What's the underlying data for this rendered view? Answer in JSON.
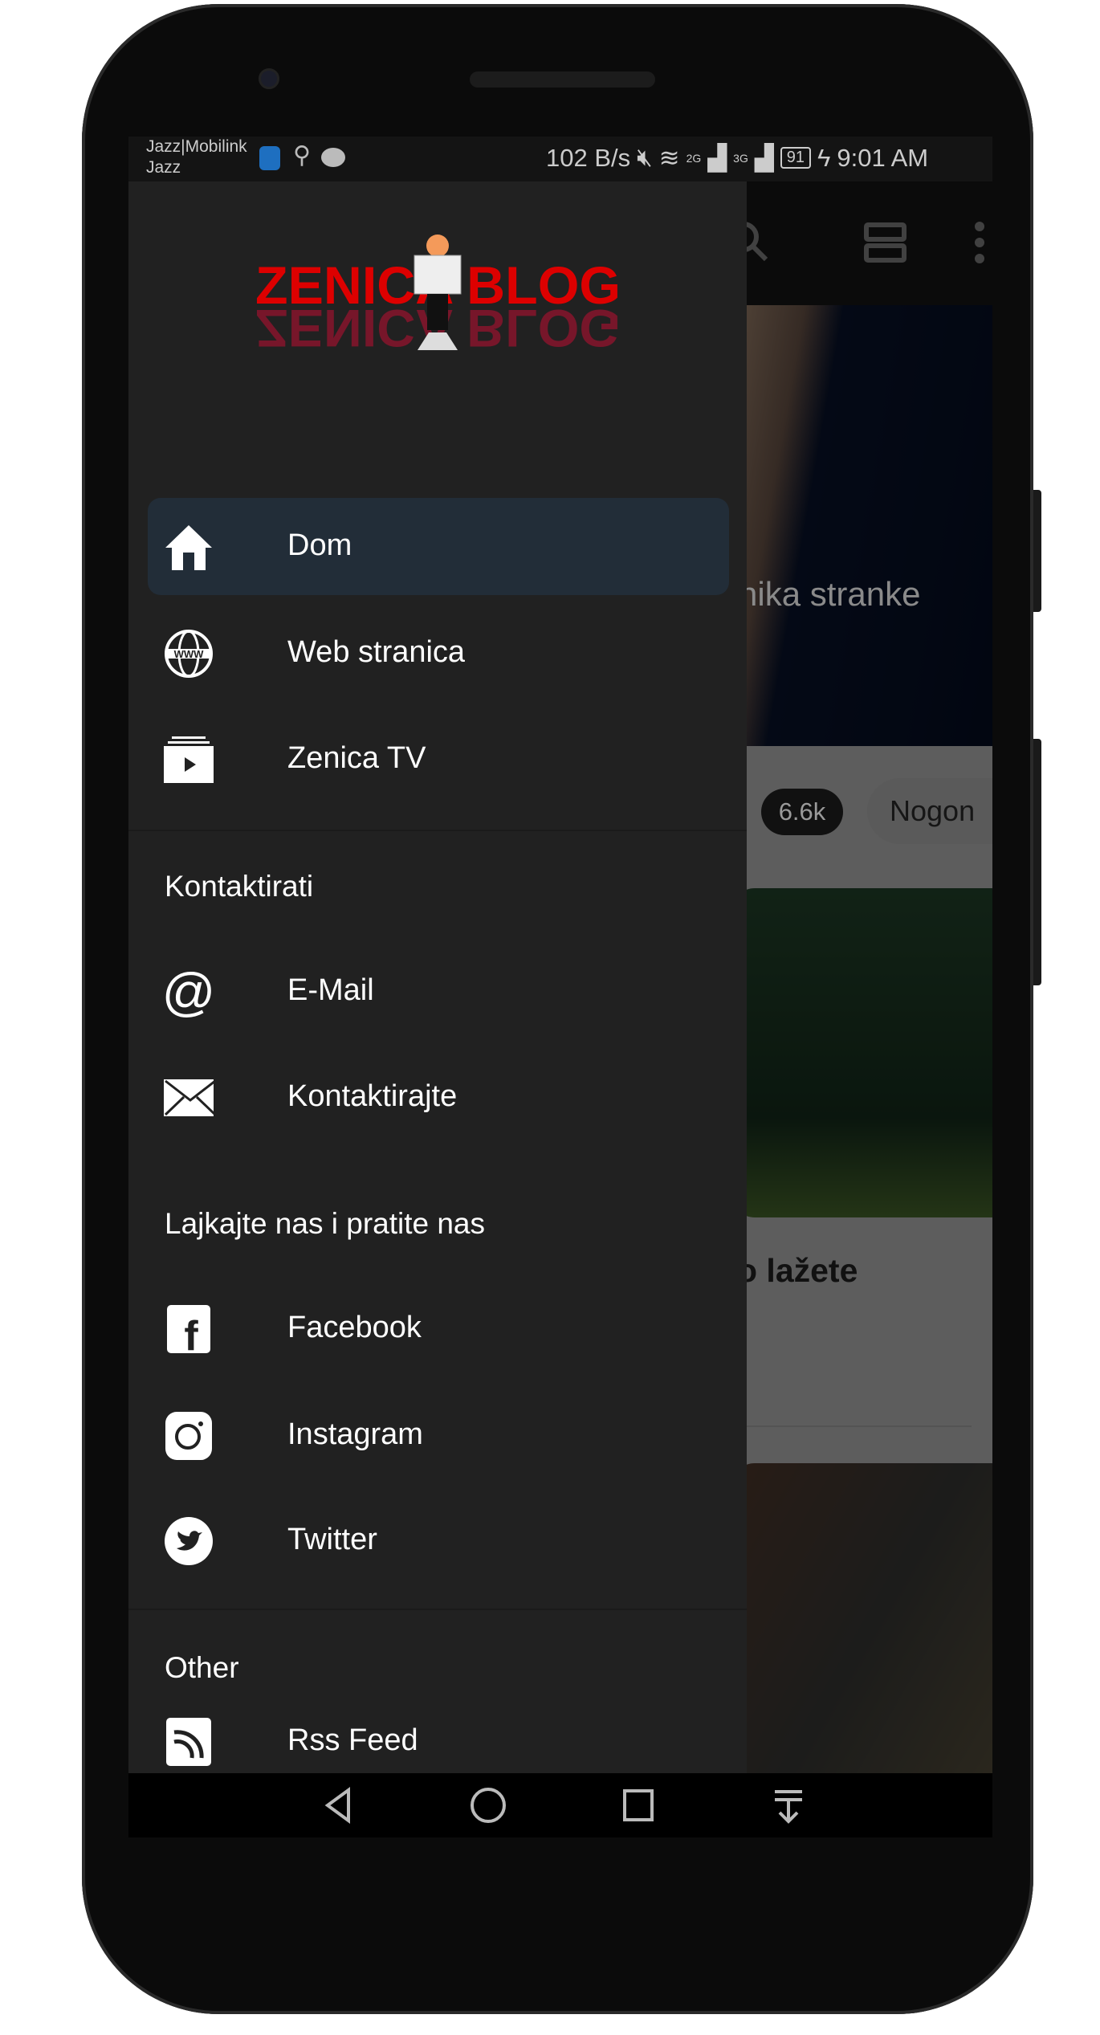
{
  "status_bar": {
    "carrier_1": "Jazz|Mobilink",
    "carrier_2": "Jazz",
    "net_speed": "102 B/s",
    "sig1": "2G",
    "sig2": "3G",
    "battery": "91",
    "time": "9:01 AM"
  },
  "drawer": {
    "logo_text": "ZENICA BLOG",
    "items": [
      {
        "label": "Dom",
        "icon": "home-icon",
        "selected": true
      },
      {
        "label": "Web stranica",
        "icon": "globe-www-icon"
      },
      {
        "label": "Zenica TV",
        "icon": "video-play-icon"
      }
    ],
    "sections": [
      {
        "header": "Kontaktirati",
        "items": [
          {
            "label": "E-Mail",
            "icon": "at-icon"
          },
          {
            "label": "Kontaktirajte",
            "icon": "envelope-icon"
          }
        ]
      },
      {
        "header": "Lajkajte nas i pratite nas",
        "items": [
          {
            "label": "Facebook",
            "icon": "facebook-icon"
          },
          {
            "label": "Instagram",
            "icon": "instagram-icon"
          },
          {
            "label": "Twitter",
            "icon": "twitter-icon"
          }
        ]
      },
      {
        "header": "Other",
        "items": [
          {
            "label": "Rss Feed",
            "icon": "rss-icon"
          }
        ]
      }
    ],
    "selected_bg": "#222d38"
  },
  "main": {
    "hero_text": "nika stranke",
    "chip_count": "6.6k",
    "chip_category": "Nogon",
    "article_title": "o lažete"
  },
  "nav_bar": {
    "back": "back-icon",
    "home": "home-circle-icon",
    "recents": "recents-icon",
    "notifications": "pull-down-icon"
  }
}
